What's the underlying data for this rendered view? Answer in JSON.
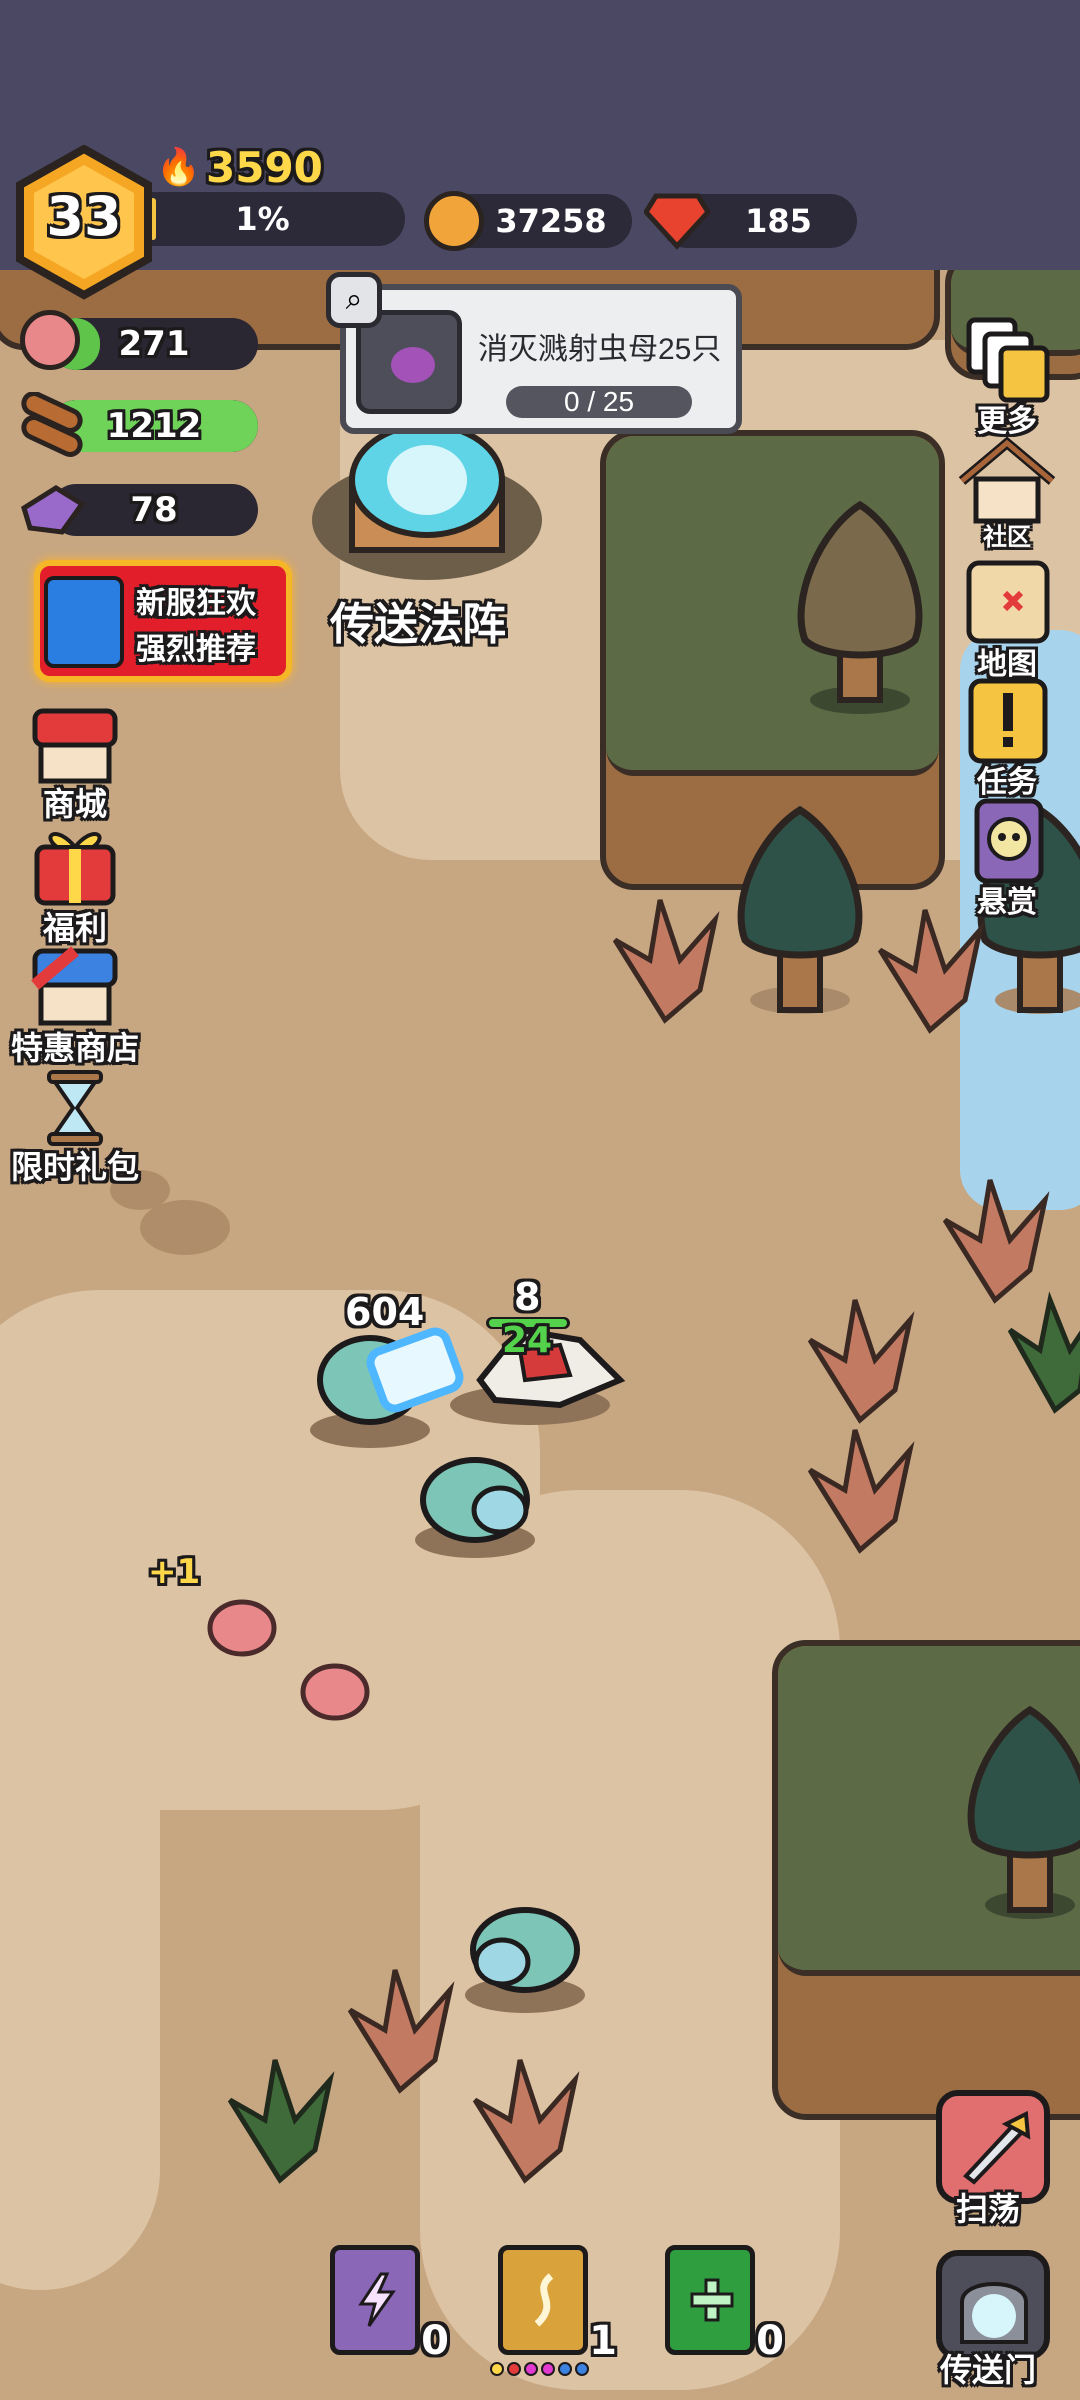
{
  "player": {
    "level": "33",
    "power": "3590",
    "exp_percent": "1%",
    "exp_fraction": 0.01
  },
  "currency": {
    "coins": "37258",
    "gems": "185"
  },
  "resources": [
    {
      "name": "meat",
      "value": "271"
    },
    {
      "name": "wood",
      "value": "1212"
    },
    {
      "name": "crystal",
      "value": "78"
    }
  ],
  "quest": {
    "text": "消灭溅射虫母25只",
    "progress": "0 / 25",
    "progress_value": 0,
    "progress_total": 25
  },
  "promo": {
    "line1": "新服狂欢",
    "line2": "强烈推荐"
  },
  "left_menu": [
    {
      "label": "商城",
      "icon": "shop-icon"
    },
    {
      "label": "福利",
      "icon": "gift-icon"
    },
    {
      "label": "特惠商店",
      "icon": "special-shop-icon"
    },
    {
      "label": "限时礼包",
      "icon": "hourglass-icon"
    }
  ],
  "right_menu": [
    {
      "label": "更多",
      "icon": "more-icon"
    },
    {
      "label": "社区",
      "icon": "house-icon"
    },
    {
      "label": "地图",
      "icon": "treasure-map-icon"
    },
    {
      "label": "任务",
      "icon": "quest-scroll-icon"
    },
    {
      "label": "悬赏",
      "icon": "bounty-skull-icon"
    }
  ],
  "world": {
    "portal_label": "传送法阵",
    "damage_big": "604",
    "damage_small": "8",
    "heal": "24",
    "pickup": "+1"
  },
  "skill_books": [
    {
      "name": "lightning",
      "count": "0",
      "color": "#8b67b8"
    },
    {
      "name": "wind",
      "count": "1",
      "color": "#d9a23a"
    },
    {
      "name": "heal",
      "count": "0",
      "color": "#2f9e3f"
    }
  ],
  "bottom_right": [
    {
      "label": "扫荡",
      "icon": "sweep-sword-icon"
    },
    {
      "label": "传送门",
      "icon": "portal-gate-icon"
    }
  ],
  "colors": {
    "level_badge": "#f5a623",
    "power_text": "#ffd84a",
    "exp_bar": "#f5c542",
    "meat_bar": "#5ec44a",
    "wood_bar": "#6fd35a",
    "gem": "#e8432f"
  }
}
